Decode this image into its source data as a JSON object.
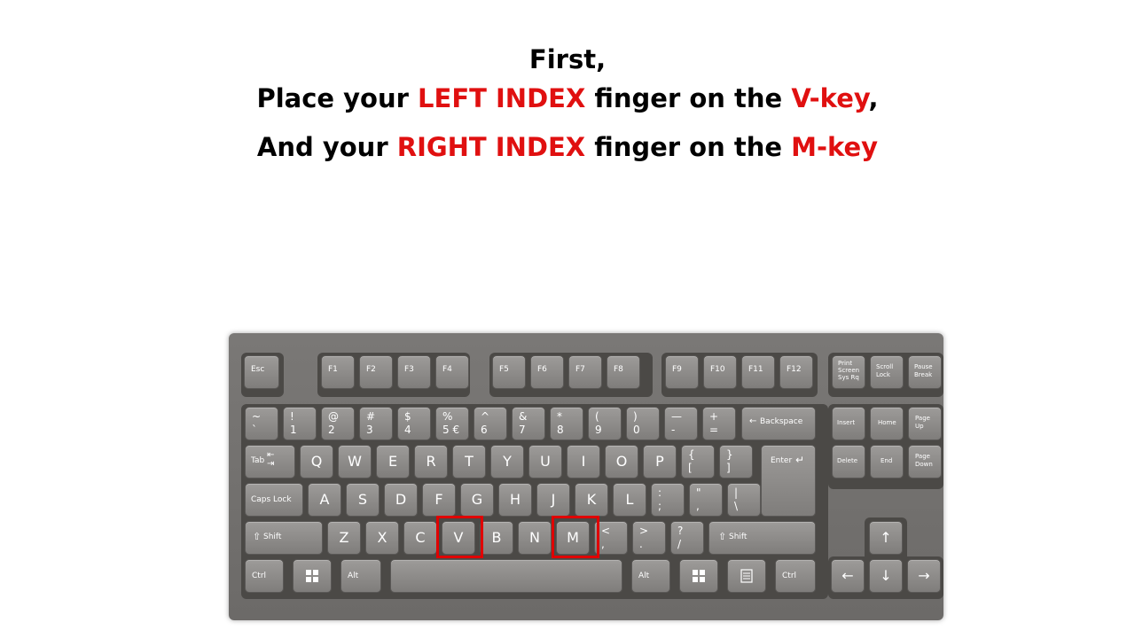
{
  "instructions": {
    "line1": "First,",
    "line2_prefix": "Place your ",
    "line2_highlight": "LEFT INDEX",
    "line2_mid": " finger on the ",
    "line2_key": "V-key",
    "line2_suffix": ",",
    "line3_prefix": "And your ",
    "line3_highlight": "RIGHT INDEX",
    "line3_mid": " finger on the ",
    "line3_key": "M-key",
    "highlight_color": "#e01010"
  },
  "keyboard": {
    "highlight_color": "#e00000",
    "highlighted_keys": [
      "V",
      "M"
    ],
    "keys": {
      "esc": "Esc",
      "f1": "F1",
      "f2": "F2",
      "f3": "F3",
      "f4": "F4",
      "f5": "F5",
      "f6": "F6",
      "f7": "F7",
      "f8": "F8",
      "f9": "F9",
      "f10": "F10",
      "f11": "F11",
      "f12": "F12",
      "prtsc_1": "Print",
      "prtsc_2": "Screen",
      "prtsc_3": "Sys Rq",
      "scroll_1": "Scroll",
      "scroll_2": "Lock",
      "pause_1": "Pause",
      "pause_2": "Break",
      "n1": [
        "~",
        "`"
      ],
      "n2": [
        "!",
        "1"
      ],
      "n3": [
        "@",
        "2"
      ],
      "n4": [
        "#",
        "3"
      ],
      "n5": [
        "$",
        "4"
      ],
      "n6": [
        "%",
        "5 €"
      ],
      "n7": [
        "^",
        "6"
      ],
      "n8": [
        "&",
        "7"
      ],
      "n9": [
        "*",
        "8"
      ],
      "n10": [
        "(",
        "9"
      ],
      "n11": [
        ")",
        "0"
      ],
      "n12": [
        "—",
        "-"
      ],
      "n13": [
        "+",
        "="
      ],
      "backspace": "Backspace",
      "insert": "Insert",
      "home": "Home",
      "pgup_1": "Page",
      "pgup_2": "Up",
      "delete": "Delete",
      "end": "End",
      "pgdn_1": "Page",
      "pgdn_2": "Down",
      "tab": "Tab",
      "q": "Q",
      "w": "W",
      "e": "E",
      "r": "R",
      "t": "T",
      "y": "Y",
      "u": "U",
      "i": "I",
      "o": "O",
      "p": "P",
      "lbracket": [
        "{",
        "["
      ],
      "rbracket": [
        "}",
        "]"
      ],
      "enter": "Enter",
      "caps": "Caps Lock",
      "a": "A",
      "s": "S",
      "d": "D",
      "f": "F",
      "g": "G",
      "h": "H",
      "j": "J",
      "k": "K",
      "l": "L",
      "semicolon": [
        ":",
        ";"
      ],
      "quote": [
        "\"",
        ","
      ],
      "backslash": [
        "|",
        "\\"
      ],
      "lshift": "Shift",
      "z": "Z",
      "x": "X",
      "c": "C",
      "v": "V",
      "b": "B",
      "n": "N",
      "m": "M",
      "comma": [
        "<",
        ","
      ],
      "period": [
        ">",
        "."
      ],
      "slash": [
        "?",
        "/"
      ],
      "rshift": "Shift",
      "lctrl": "Ctrl",
      "lalt": "Alt",
      "ralt": "Alt",
      "rctrl": "Ctrl",
      "arrow_up": "↑",
      "arrow_left": "←",
      "arrow_down": "↓",
      "arrow_right": "→"
    }
  }
}
